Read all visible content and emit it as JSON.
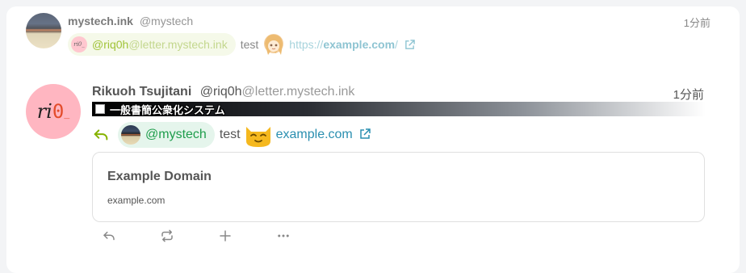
{
  "parent_note": {
    "display_name": "mystech.ink",
    "username": "@mystech",
    "time": "1分前",
    "mention": {
      "user": "@riq0h",
      "host": "@letter.mystech.ink",
      "avatar_text": "ri0_"
    },
    "text": "test",
    "emoji": "girl-custom-emoji",
    "link": {
      "prefix": "https://",
      "domain": "example.com",
      "suffix": "/"
    }
  },
  "note": {
    "avatar_text": {
      "a": "ri",
      "b": "0",
      "c": "_"
    },
    "display_name": "Rikuoh Tsujitani",
    "username": "@riq0h",
    "host": "@letter.mystech.ink",
    "time": "1分前",
    "instance_name": "一般書簡公衆化システム",
    "reply_indicator": "reply-icon",
    "mention": "@mystech",
    "text": "test",
    "emoji": "cat-custom-emoji",
    "link": "example.com"
  },
  "url_preview": {
    "title": "Example Domain",
    "site": "example.com"
  },
  "footer": {
    "buttons": [
      "reply-icon",
      "renote-icon",
      "plus-icon",
      "more-icon"
    ]
  },
  "colors": {
    "mention_green": "#1f9d4c",
    "mention_bg": "#e5f5ec",
    "link": "#2a8fb0",
    "avatar_pink": "#ffb6c1"
  }
}
